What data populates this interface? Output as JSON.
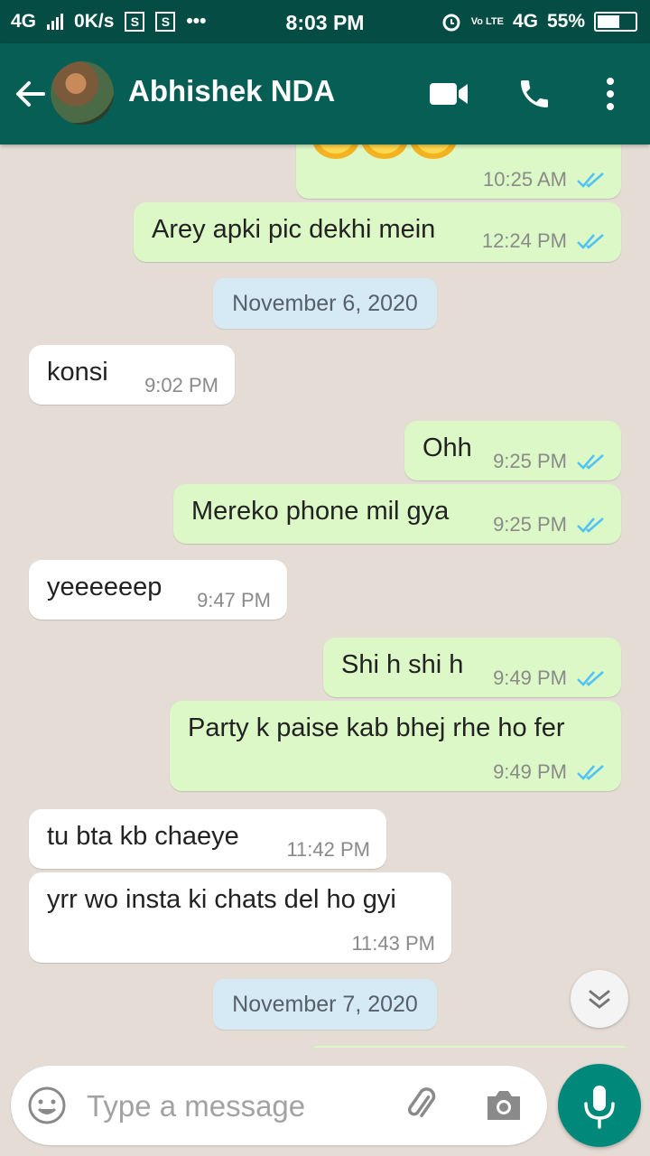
{
  "status_bar": {
    "network": "4G",
    "speed": "0K/s",
    "time": "8:03 PM",
    "volte": "Vo LTE",
    "network2": "4G",
    "battery": "55%",
    "battery_level": 0.55
  },
  "header": {
    "contact_name": "Abhishek NDA",
    "icons": [
      "back-arrow-icon",
      "video-call-icon",
      "phone-icon",
      "more-vert-icon"
    ]
  },
  "messages": [
    {
      "dir": "out",
      "text": "",
      "emoji": 3,
      "time": "10:25 AM",
      "read": true
    },
    {
      "dir": "out",
      "text": "Arey apki pic dekhi mein",
      "time": "12:24 PM",
      "read": true
    },
    {
      "type": "date",
      "text": "November 6, 2020"
    },
    {
      "dir": "in",
      "text": "konsi",
      "time": "9:02 PM"
    },
    {
      "dir": "out",
      "text": "Ohh",
      "time": "9:25 PM",
      "read": true
    },
    {
      "dir": "out",
      "text": "Mereko phone mil gya",
      "time": "9:25 PM",
      "read": true
    },
    {
      "dir": "in",
      "text": "yeeeeeep",
      "time": "9:47 PM"
    },
    {
      "dir": "out",
      "text": "Shi h shi h",
      "time": "9:49 PM",
      "read": true
    },
    {
      "dir": "out",
      "text": "Party k paise kab bhej rhe ho fer",
      "time": "9:49 PM",
      "read": true
    },
    {
      "dir": "in",
      "text": "tu bta kb chaeye",
      "time": "11:42 PM"
    },
    {
      "dir": "in",
      "text": "yrr wo insta ki chats del ho gyi",
      "time": "11:43 PM"
    },
    {
      "type": "date",
      "text": "November 7, 2020"
    }
  ],
  "composer": {
    "placeholder": "Type a message",
    "icons": [
      "emoji-icon",
      "attach-icon",
      "camera-icon",
      "mic-icon"
    ]
  },
  "colors": {
    "status_bar": "#054d44",
    "app_bar": "#075e54",
    "outgoing_bubble": "#dcf8c6",
    "incoming_bubble": "#ffffff",
    "chat_bg": "#e5ddd5",
    "read_tick": "#4fc3f7",
    "fab": "#00897b"
  }
}
